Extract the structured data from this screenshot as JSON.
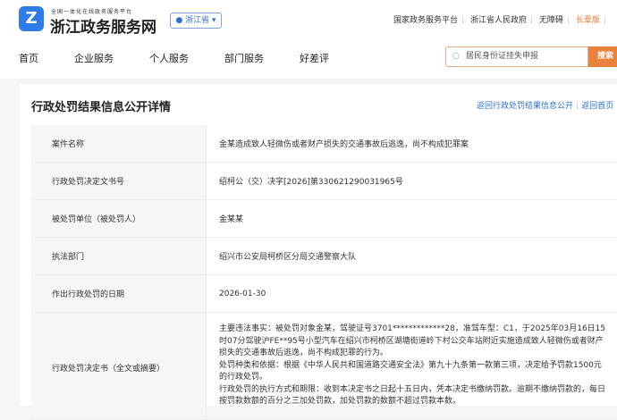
{
  "header": {
    "logo_icon": "zhejiang-logo",
    "logo_sub": "全国一体化在线政务服务平台",
    "logo_title": "浙江政务服务网",
    "region": "浙江省",
    "top_links": [
      "国家政务服务平台",
      "浙江省人民政府",
      "无障碍",
      "长辈版"
    ],
    "accent": "#e8823c"
  },
  "nav": [
    "首页",
    "企业服务",
    "个人服务",
    "部门服务",
    "好差评"
  ],
  "search": {
    "placeholder": "居民身份证挂失申报",
    "button": "搜索"
  },
  "page": {
    "title": "行政处罚结果信息公开详情",
    "back_list": "返回行政处罚结果信息公开",
    "back_home": "返回首页"
  },
  "rows": [
    {
      "label": "案件名称",
      "value": "金某造成致人轻微伤或者财产损失的交通事故后逃逸，尚不构成犯罪案"
    },
    {
      "label": "行政处罚决定文书号",
      "value": "绍柯公（交）决字[2026]第330621290031965号"
    },
    {
      "label": "被处罚单位（被处罚人）",
      "value": "金某某"
    },
    {
      "label": "执法部门",
      "value": "绍兴市公安局柯桥区分局交通警察大队"
    },
    {
      "label": "作出行政处罚的日期",
      "value": "2026-01-30"
    },
    {
      "label": "行政处罚决定书（全文或摘要）",
      "lines": [
        "主要违法事实：被处罚对象金某，驾驶证号3701*************28，准驾车型：C1，于2025年03月16日15时07分驾驶沪FE**95号小型汽车在绍兴市柯桥区湖塘街道岭下村公交车站附近实施造成致人轻微伤或者财产损失的交通事故后逃逸，尚不构成犯罪的行为。",
        "处罚种类和依据：根据《中华人民共和国道路交通安全法》第九十九条第一款第三项，决定给予罚款1500元的行政处罚。",
        "行政处罚的执行方式和期限：收到本决定书之日起十五日内，凭本决定书缴纳罚款。逾期不缴纳罚款的，每日按罚款数额的百分之三加处罚款，加处罚款的数额不超过罚款本数。"
      ]
    }
  ]
}
